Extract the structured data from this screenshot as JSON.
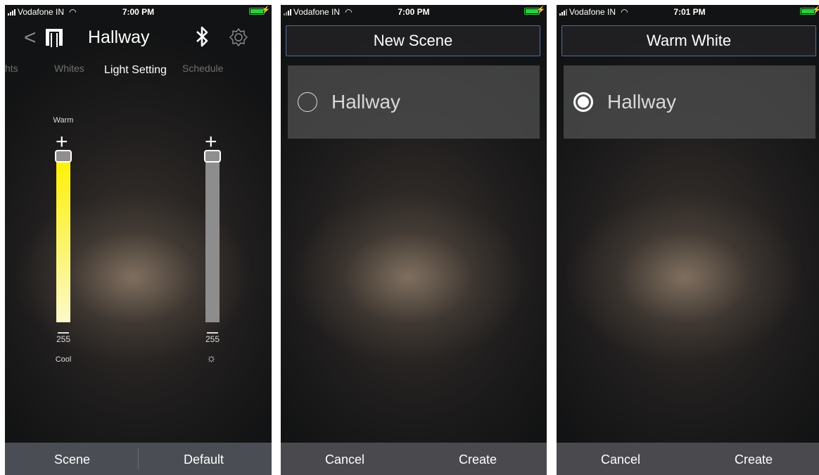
{
  "panel1": {
    "status": {
      "carrier": "Vodafone IN",
      "time": "7:00 PM"
    },
    "nav": {
      "title": "Hallway"
    },
    "tabs": [
      "hts",
      "Whites",
      "Light Setting",
      "Schedule"
    ],
    "warm_label": "Warm",
    "cool_label": "Cool",
    "warm_value": "255",
    "bright_value": "255",
    "warm_level": 1.0,
    "bright_level": 1.0,
    "bottom": {
      "left": "Scene",
      "right": "Default"
    }
  },
  "panel2": {
    "status": {
      "carrier": "Vodafone IN",
      "time": "7:00 PM"
    },
    "scene_name": "New Scene",
    "light_label": "Hallway",
    "selected": false,
    "bottom": {
      "cancel": "Cancel",
      "create": "Create"
    }
  },
  "panel3": {
    "status": {
      "carrier": "Vodafone IN",
      "time": "7:01 PM"
    },
    "scene_name": "Warm White",
    "light_label": "Hallway",
    "selected": true,
    "bottom": {
      "cancel": "Cancel",
      "create": "Create"
    }
  },
  "colors": {
    "warm_top": "#fff200",
    "accent_border": "#4e6fa3",
    "battery": "#2ecc40",
    "bottom_bar": "#4b4d55"
  },
  "icons": [
    "signal-icon",
    "wifi-icon",
    "battery-icon",
    "back-chevron-icon",
    "lamp-icon",
    "bluetooth-icon",
    "gear-icon",
    "plus-icon",
    "sun-icon",
    "radio-icon"
  ]
}
